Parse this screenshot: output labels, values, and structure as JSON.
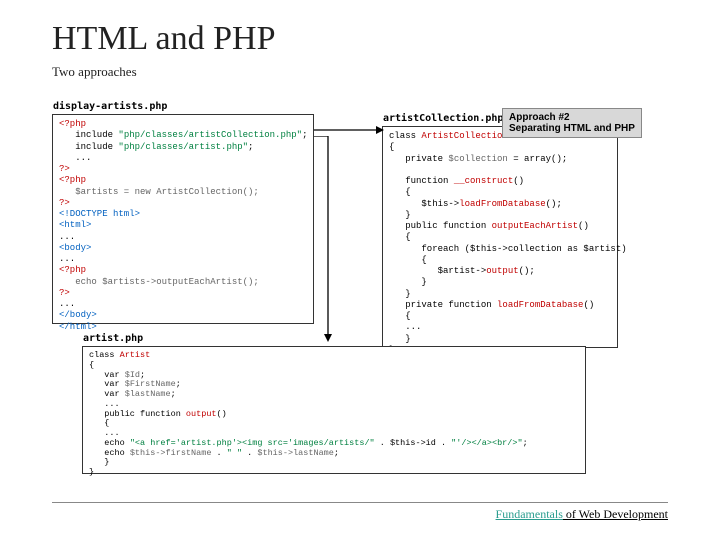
{
  "title": "HTML and PHP",
  "subtitle": "Two approaches",
  "approach": {
    "title": "Approach #2",
    "desc": "Separating HTML and PHP"
  },
  "boxes": {
    "display": {
      "label": "display-artists.php",
      "l1": "<?php",
      "l2": "   include ",
      "l2s": "\"php/classes/artistCollection.php\"",
      "l3": "   include ",
      "l3s": "\"php/classes/artist.php\"",
      "l4": "   ...",
      "l5": "?>",
      "l6": "<?php",
      "l7": "   $artists = new ArtistCollection();",
      "l8": "?>",
      "l9": "<!DOCTYPE html>",
      "l10": "<html>",
      "l11": "...",
      "l12": "<body>",
      "l13": "...",
      "l14": "<?php",
      "l15": "   echo $artists->outputEachArtist();",
      "l16": "?>",
      "l17": "...",
      "l18": "</body>",
      "l19": "</html>"
    },
    "collection": {
      "label": "artistCollection.php",
      "l1": "class ",
      "l1b": "ArtistCollection",
      "l2": "{",
      "l3": "   private ",
      "l3b": "$collection",
      "l3c": " = array();",
      "l4": "",
      "l5": "   function ",
      "l5b": "__construct",
      "l5c": "()",
      "l6": "   {",
      "l7": "      $this->",
      "l7b": "loadFromDatabase",
      "l7c": "();",
      "l8": "   }",
      "l9": "   public function ",
      "l9b": "outputEachArtist",
      "l9c": "()",
      "l10": "   {",
      "l11": "      foreach ($this->collection as $artist)",
      "l12": "      {",
      "l13": "         $artist->",
      "l13b": "output",
      "l13c": "();",
      "l14": "      }",
      "l15": "   }",
      "l16": "   private function ",
      "l16b": "loadFromDatabase",
      "l16c": "()",
      "l17": "   {",
      "l18": "   ...",
      "l19": "   }",
      "l20": "}"
    },
    "artist": {
      "label": "artist.php",
      "l1": "class ",
      "l1b": "Artist",
      "l2": "{",
      "l3": "   var ",
      "l3b": "$Id",
      "l3c": ";",
      "l4": "   var ",
      "l4b": "$FirstName",
      "l4c": ";",
      "l5": "   var ",
      "l5b": "$lastName",
      "l5c": ";",
      "l6": "   ...",
      "l7": "   public function ",
      "l7b": "output",
      "l7c": "()",
      "l8": "   {",
      "l9": "   ...",
      "l10": "   echo ",
      "l10s": "\"<a href='artist.php'><img src='images/artists/\"",
      "l10d": " . $this->id . ",
      "l10e": "\"'/></a><br/>\"",
      "l10f": ";",
      "l11": "   echo ",
      "l11b": "$this->firstName",
      "l11c": " . ",
      "l11s": "\" \"",
      "l11d": " . ",
      "l11e": "$this->lastName",
      "l11f": ";",
      "l12": "   }",
      "l13": "}"
    }
  },
  "footer": {
    "word1": "Fundamentals",
    "rest": " of Web Development"
  }
}
